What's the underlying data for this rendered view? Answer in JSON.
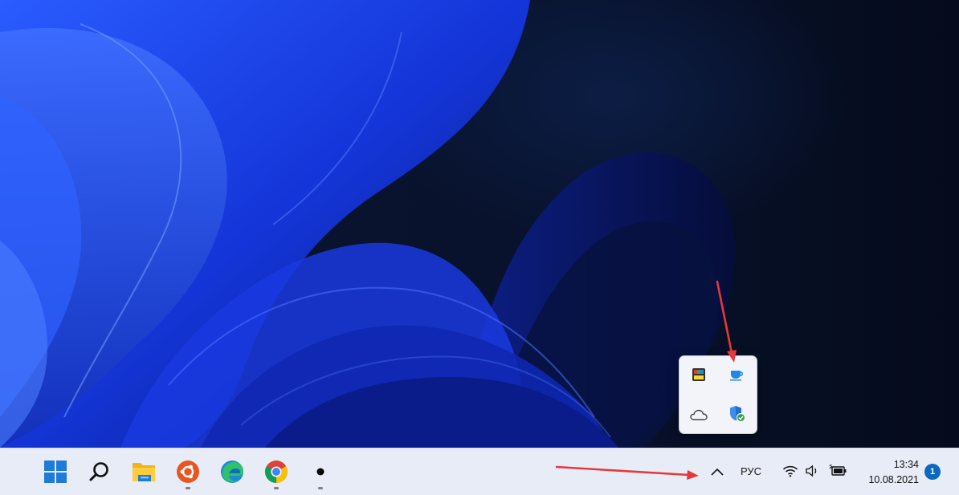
{
  "desktop": {
    "wallpaper": "Windows 11 Bloom blue"
  },
  "taskbar": {
    "pinned": [
      {
        "id": "start",
        "icon": "windows-start-icon"
      },
      {
        "id": "search",
        "icon": "search-icon"
      },
      {
        "id": "file-explorer",
        "icon": "folder-icon"
      },
      {
        "id": "ubuntu",
        "icon": "ubuntu-icon"
      },
      {
        "id": "edge",
        "icon": "edge-icon"
      },
      {
        "id": "chrome",
        "icon": "chrome-icon"
      },
      {
        "id": "unknown-app",
        "icon": "dot-icon"
      }
    ],
    "tray": {
      "language": "РУС",
      "time": "13:34",
      "date": "10.08.2021",
      "notification_count": "1"
    }
  },
  "tray_flyout": {
    "icons": [
      "color-palette-icon",
      "cup-icon",
      "cloud-icon",
      "shield-check-icon"
    ]
  },
  "colors": {
    "taskbar_bg": "#e7ecf6",
    "accent": "#0a67c2",
    "annotation_arrow": "#e5393b"
  }
}
